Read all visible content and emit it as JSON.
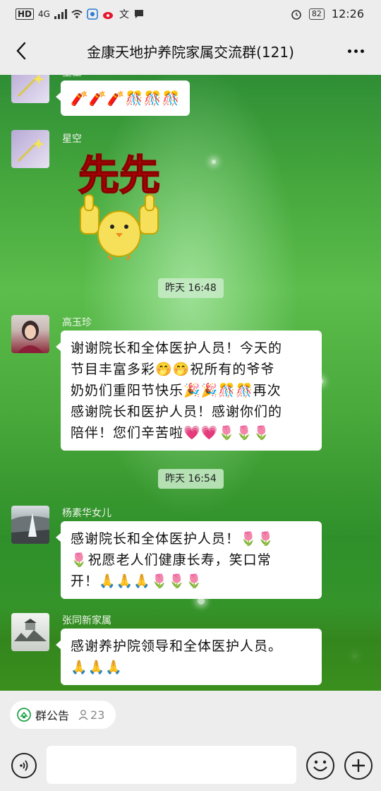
{
  "status_bar": {
    "hd": "HD",
    "network": "4G",
    "battery": "82",
    "time": "12:26"
  },
  "header": {
    "title": "金康天地护养院家属交流群(121)"
  },
  "messages": [
    {
      "sender": "星空",
      "text": "🧨🧨🧨🎊🎊🎊"
    },
    {
      "sender": "星空",
      "sticker": "thumbs-up-chick-sticker",
      "sticker_text": "先先"
    },
    {
      "time": "昨天 16:48"
    },
    {
      "sender": "高玉珍",
      "lines": [
        "谢谢院长和全体医护人员！今天的",
        "节目丰富多彩🤭🤭祝所有的爷爷",
        "奶奶们重阳节快乐🎉🎉🎊🎊再次",
        "感谢院长和医护人员！感谢你们的",
        "陪伴！您们辛苦啦💗💗🌷🌷🌷"
      ]
    },
    {
      "time": "昨天 16:54"
    },
    {
      "sender": "杨素华女儿",
      "lines": [
        "感谢院长和全体医护人员！🌷🌷",
        "🌷祝愿老人们健康长寿，笑口常",
        "开！🙏🙏🙏🌷🌷🌷"
      ]
    },
    {
      "sender": "张同新家属",
      "lines": [
        "感谢养护院领导和全体医护人员。",
        "🙏🙏🙏"
      ]
    }
  ],
  "bottom": {
    "notice_label": "群公告",
    "notice_count": "23",
    "input_placeholder": ""
  },
  "colors": {
    "bubble": "#ffffff",
    "time_chip": "#c8ebc8",
    "chrome": "#ededed"
  }
}
